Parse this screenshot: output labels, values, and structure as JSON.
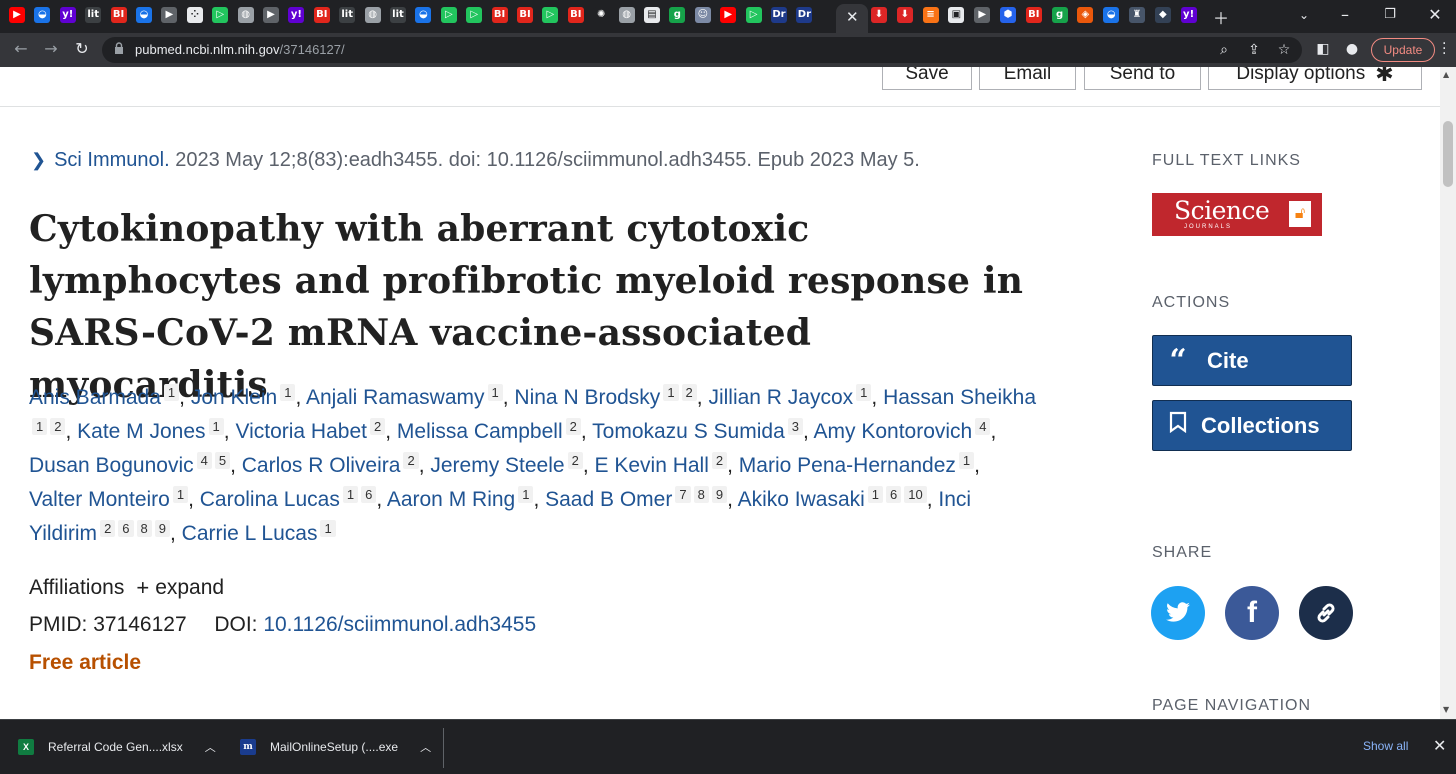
{
  "browser": {
    "tab_favicons": [
      "youtube-icon",
      "vpn-shield-icon",
      "yahoo-icon",
      "lit-icon",
      "bi-icon",
      "vpn-shield-icon",
      "arrow-tag-icon",
      "puzzle-icon",
      "play-green-icon",
      "globe-icon",
      "arrow-tag-icon",
      "yahoo-icon",
      "bi-icon",
      "lit-icon",
      "globe-icon",
      "lit-icon",
      "vpn-shield-icon",
      "play-green-icon",
      "play-green-icon",
      "bi-icon",
      "bi-icon",
      "play-green-icon",
      "bi-icon",
      "burst-icon",
      "globe-icon",
      "news-icon",
      "g-green-icon",
      "portrait-icon",
      "youtube-icon",
      "play-green-icon",
      "dr-icon",
      "dr-icon"
    ],
    "tab_favicons_right": [
      "red-pin-icon",
      "red-pin-icon",
      "stack-icon",
      "qr-icon",
      "arrow-tag-icon",
      "hex-icon",
      "bi-icon",
      "g-green-icon",
      "shield-orange-icon",
      "vpn-shield-icon",
      "castle-icon",
      "shield-dark-icon",
      "yahoo-icon"
    ],
    "favicon_letters": {
      "yahoo": "y!",
      "bi": "BI",
      "lit": "lit",
      "dr": "Dr",
      "g": "g"
    },
    "url_host": "pubmed.ncbi.nlm.nih.gov",
    "url_path": "/37146127/",
    "update_label": "Update"
  },
  "page": {
    "toolbar_buttons": [
      "Save",
      "Email",
      "Send to",
      "Display options"
    ],
    "citation": {
      "journal": "Sci Immunol.",
      "details": "2023 May 12;8(83):eadh3455. doi: 10.1126/sciimmunol.adh3455. Epub 2023 May 5."
    },
    "title": "Cytokinopathy with aberrant cytotoxic lymphocytes and profibrotic myeloid response in SARS-CoV-2 mRNA vaccine-associated myocarditis",
    "authors": [
      {
        "name": "Anis Barmada",
        "aff": [
          "1"
        ]
      },
      {
        "name": "Jon Klein",
        "aff": [
          "1"
        ]
      },
      {
        "name": "Anjali Ramaswamy",
        "aff": [
          "1"
        ]
      },
      {
        "name": "Nina N Brodsky",
        "aff": [
          "1",
          "2"
        ]
      },
      {
        "name": "Jillian R Jaycox",
        "aff": [
          "1"
        ]
      },
      {
        "name": "Hassan Sheikha",
        "aff": [
          "1",
          "2"
        ]
      },
      {
        "name": "Kate M Jones",
        "aff": [
          "1"
        ]
      },
      {
        "name": "Victoria Habet",
        "aff": [
          "2"
        ]
      },
      {
        "name": "Melissa Campbell",
        "aff": [
          "2"
        ]
      },
      {
        "name": "Tomokazu S Sumida",
        "aff": [
          "3"
        ]
      },
      {
        "name": "Amy Kontorovich",
        "aff": [
          "4"
        ]
      },
      {
        "name": "Dusan Bogunovic",
        "aff": [
          "4",
          "5"
        ]
      },
      {
        "name": "Carlos R Oliveira",
        "aff": [
          "2"
        ]
      },
      {
        "name": "Jeremy Steele",
        "aff": [
          "2"
        ]
      },
      {
        "name": "E Kevin Hall",
        "aff": [
          "2"
        ]
      },
      {
        "name": "Mario Pena-Hernandez",
        "aff": [
          "1"
        ]
      },
      {
        "name": "Valter Monteiro",
        "aff": [
          "1"
        ]
      },
      {
        "name": "Carolina Lucas",
        "aff": [
          "1",
          "6"
        ]
      },
      {
        "name": "Aaron M Ring",
        "aff": [
          "1"
        ]
      },
      {
        "name": "Saad B Omer",
        "aff": [
          "7",
          "8",
          "9"
        ]
      },
      {
        "name": "Akiko Iwasaki",
        "aff": [
          "1",
          "6",
          "10"
        ]
      },
      {
        "name": "Inci Yildirim",
        "aff": [
          "2",
          "6",
          "8",
          "9"
        ]
      },
      {
        "name": "Carrie L Lucas",
        "aff": [
          "1"
        ]
      }
    ],
    "affiliations_label": "Affiliations",
    "expand_label": "expand",
    "pmid_label": "PMID:",
    "pmid": "37146127",
    "doi_label": "DOI:",
    "doi": "10.1126/sciimmunol.adh3455",
    "free_article": "Free article"
  },
  "sidebar": {
    "full_text_heading": "FULL TEXT LINKS",
    "publisher_logo_text": "Science",
    "publisher_logo_sub": "JOURNALS",
    "actions_heading": "ACTIONS",
    "cite_label": "Cite",
    "collections_label": "Collections",
    "share_heading": "SHARE",
    "page_nav_heading": "PAGE NAVIGATION",
    "colors": {
      "twitter": "#1da1f2",
      "facebook": "#3b5998",
      "link": "#1c2e4a",
      "button": "#205493"
    }
  },
  "downloads": {
    "items": [
      {
        "name": "Referral Code Gen....xlsx",
        "icon": "excel-icon"
      },
      {
        "name": "MailOnlineSetup (....exe",
        "icon": "mailonline-icon"
      }
    ],
    "show_all": "Show all"
  }
}
